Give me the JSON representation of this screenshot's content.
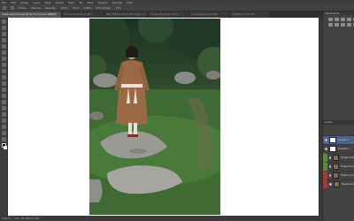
{
  "menubar": {
    "items": [
      "File",
      "Edit",
      "Image",
      "Layer",
      "Type",
      "Select",
      "Filter",
      "3D",
      "View",
      "Plugins",
      "Window",
      "Help"
    ]
  },
  "options_bar": {
    "items": [
      "Mode:",
      "Normal",
      "Opacity:",
      "100%",
      "Flow:",
      "100%",
      "Smoothing:",
      "10%"
    ]
  },
  "tabs": [
    {
      "label": "model-portrait-1.psd @ 16.7% (Curves, RGB/8*)",
      "active": true
    },
    {
      "label": "retouch-final.psd @ 25%",
      "active": false
    },
    {
      "label": "IMG_7835.psd @ 33.3% (Layer 1)",
      "active": false
    },
    {
      "label": "forest-edit.psd @ 12.5%",
      "active": false
    },
    {
      "label": "color-grade.psd @ 50%",
      "active": false
    },
    {
      "label": "Untitled-1 @ 66.7%",
      "active": false
    }
  ],
  "status": {
    "zoom": "16.67%",
    "doc_info": "Doc: 68.7M/412.3M"
  },
  "panels": {
    "adjustments_title": "Adjustments",
    "layers_title": "Layers",
    "layers": [
      {
        "name": "Curves 3",
        "type": "adjustment",
        "highlight": "none",
        "selected": true
      },
      {
        "name": "Hue/Sat 1",
        "type": "adjustment",
        "highlight": "none",
        "selected": false
      },
      {
        "name": "Dodge & Burn",
        "type": "layer",
        "highlight": "green",
        "selected": false
      },
      {
        "name": "Frequency High",
        "type": "layer",
        "highlight": "green",
        "selected": false
      },
      {
        "name": "Frequency Low",
        "type": "layer",
        "highlight": "red",
        "selected": false
      },
      {
        "name": "Background",
        "type": "layer",
        "highlight": "red",
        "selected": false
      }
    ]
  },
  "colors": {
    "canvas_bg": "#ffffff",
    "app_bg": "#535353",
    "selection_blue": "#4a6388",
    "label_green": "#5b8a3a",
    "label_red": "#a63b2f"
  }
}
